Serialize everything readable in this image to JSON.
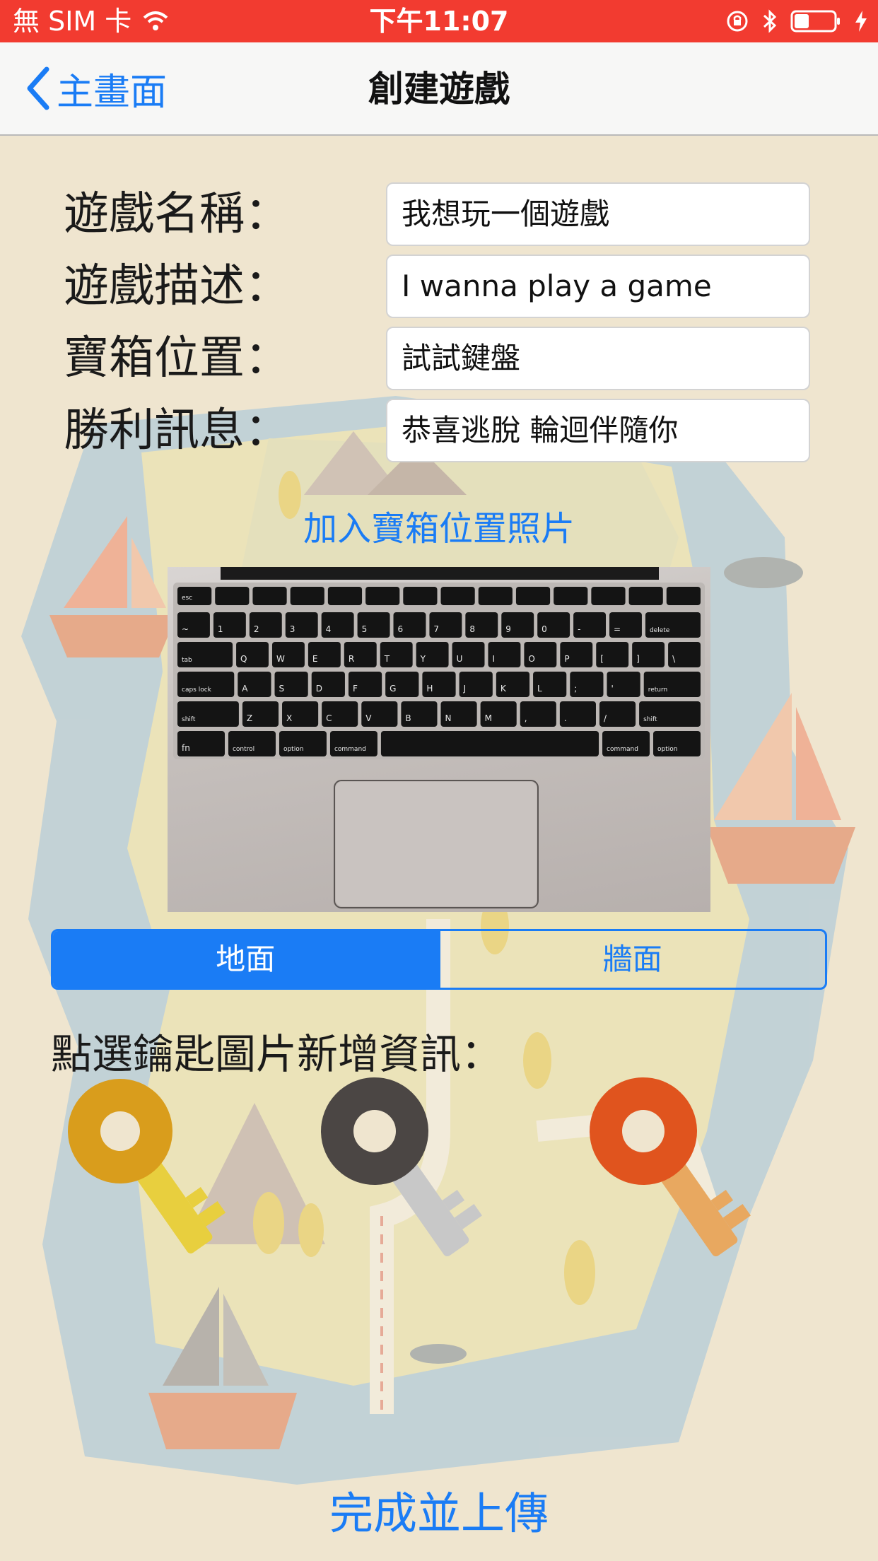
{
  "status_bar": {
    "carrier": "無 SIM 卡",
    "time": "下午11:07"
  },
  "nav": {
    "back_label": "主畫面",
    "title": "創建遊戲"
  },
  "form": {
    "fields": [
      {
        "label": "遊戲名稱：",
        "value": "我想玩一個遊戲"
      },
      {
        "label": "遊戲描述：",
        "value": "I wanna play a game"
      },
      {
        "label": "寶箱位置：",
        "value": "試試鍵盤"
      },
      {
        "label": "勝利訊息：",
        "value": "恭喜逃脫 輪迴伴隨你"
      }
    ]
  },
  "add_photo_label": "加入寶箱位置照片",
  "photo": {
    "keyboard_rows": [
      [
        "esc",
        "",
        "",
        "",
        "",
        "",
        "",
        "",
        "",
        "",
        "",
        "",
        "",
        ""
      ],
      [
        "~",
        "1",
        "2",
        "3",
        "4",
        "5",
        "6",
        "7",
        "8",
        "9",
        "0",
        "-",
        "=",
        "delete"
      ],
      [
        "tab",
        "Q",
        "W",
        "E",
        "R",
        "T",
        "Y",
        "U",
        "I",
        "O",
        "P",
        "[",
        "]",
        "\\"
      ],
      [
        "caps lock",
        "A",
        "S",
        "D",
        "F",
        "G",
        "H",
        "J",
        "K",
        "L",
        ";",
        "'",
        "return"
      ],
      [
        "shift",
        "Z",
        "X",
        "C",
        "V",
        "B",
        "N",
        "M",
        ",",
        ".",
        "/",
        "shift"
      ],
      [
        "fn",
        "control",
        "option",
        "command",
        "",
        "command",
        "option"
      ]
    ]
  },
  "segmented": {
    "options": [
      "地面",
      "牆面"
    ],
    "selected": "地面"
  },
  "keys_heading": "點選鑰匙圖片新增資訊：",
  "keys": [
    {
      "name": "gold",
      "color": "#e0a020"
    },
    {
      "name": "black",
      "color": "#4a4543"
    },
    {
      "name": "orange",
      "color": "#e0541e"
    }
  ],
  "finish_label": "完成並上傳",
  "colors": {
    "accent": "#1a7cf5",
    "status_bar": "#f23b30",
    "background": "#efe5cf"
  }
}
